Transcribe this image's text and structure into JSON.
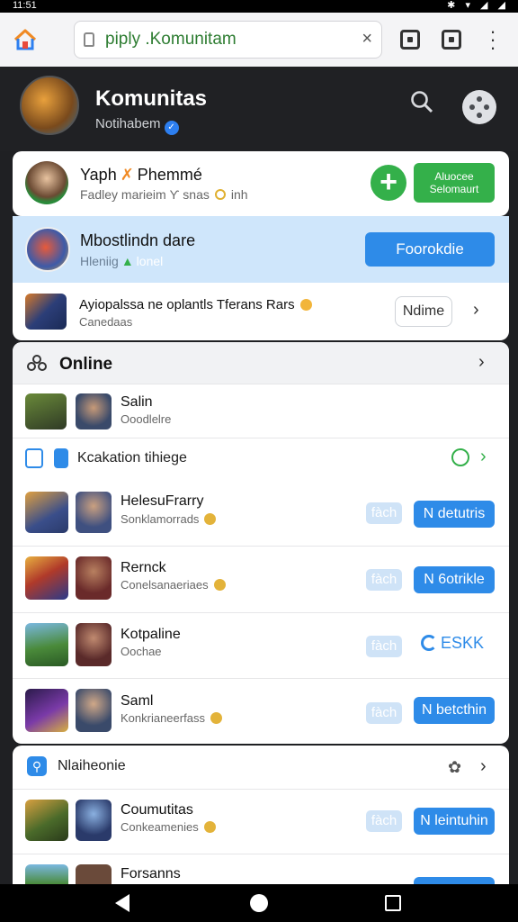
{
  "status_bar": {
    "time": "11:51"
  },
  "browser": {
    "url": "piply .Komunitam",
    "clear": "×"
  },
  "header": {
    "title": "Komunitas",
    "subtitle": "Notihabem"
  },
  "profile_card": {
    "name": "Yaph",
    "name2": "Phemmé",
    "subtitle": "Fadley marieim  Ƴ snas",
    "subtitle2": "inh",
    "plus": "+",
    "action_label": "Aluocee Selomaurt"
  },
  "highlight_card": {
    "title": "Mbostlindn dare",
    "sub": "Hleniig",
    "sub2": "lonel",
    "action_label": "Foorokdie"
  },
  "promo_card": {
    "text": "Ayiopalssa ne oplantls  Tferans Rars",
    "sub": "Canedaas",
    "button_label": "Ndime",
    "chevron": "›"
  },
  "online_section": {
    "title": "Online",
    "chevron": "›",
    "first_item": {
      "name": "Salin",
      "sub": "Ooodlelre"
    },
    "notice": {
      "label": "Kcakation tihiege",
      "chevron": "›"
    }
  },
  "users": [
    {
      "name": "HelesuFrarry",
      "sub": "Sonklamorrads",
      "pale": "fàch",
      "action": "N detutris",
      "action_style": "button"
    },
    {
      "name": "Rernck",
      "sub": "Conelsanaeriaes",
      "pale": "fàch",
      "action": "N 6otrikle",
      "action_style": "button"
    },
    {
      "name": "Kotpaline",
      "sub": "Oochae",
      "pale": "fàch",
      "action": "ESKK",
      "action_style": "link"
    },
    {
      "name": "Saml",
      "sub": "Konkrianeerfass",
      "pale": "fàch",
      "action": "N betcthin",
      "action_style": "button"
    }
  ],
  "bottom_section": {
    "title": "Nlaiheonie",
    "chevron": "›",
    "items": [
      {
        "name": "Coumutitas",
        "sub": "Conkeamenies",
        "pale": "fàch",
        "action": "N leintuhin"
      },
      {
        "name": "Forsanns",
        "sub": "",
        "pale": "",
        "action": ""
      }
    ]
  },
  "colors": {
    "accent_blue": "#2e8be8",
    "green": "#34b04a",
    "header_bg": "#202124"
  }
}
